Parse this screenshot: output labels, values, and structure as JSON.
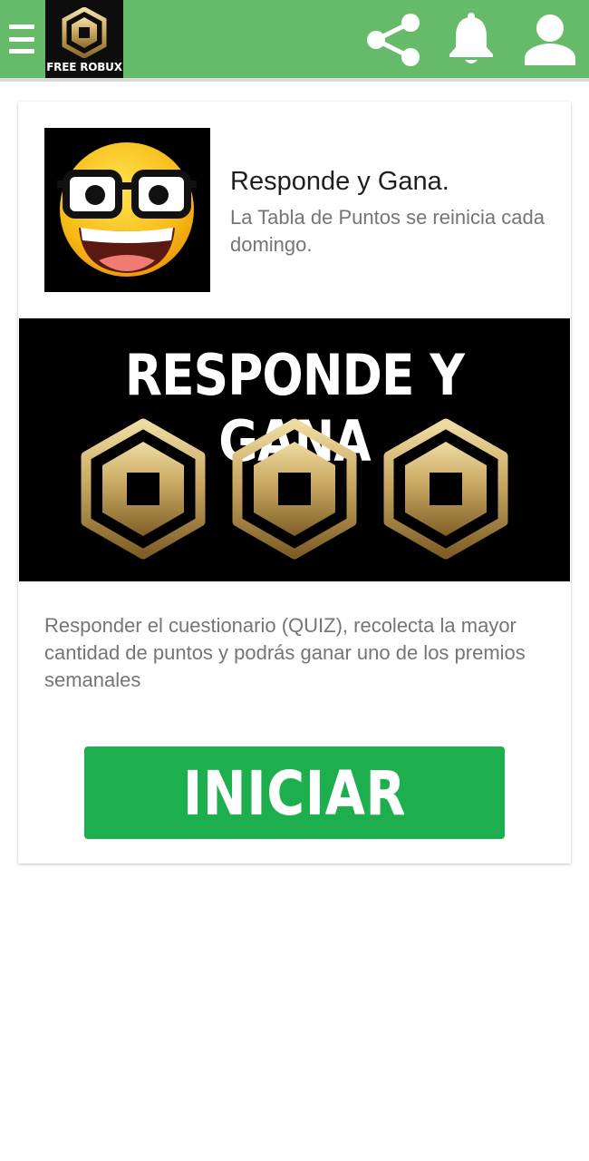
{
  "header": {
    "logo_text": "FREE ROBUX",
    "icons": [
      "menu-icon",
      "share-icon",
      "bell-icon",
      "user-icon"
    ],
    "bar_color": "#66bb6a"
  },
  "card": {
    "thumbnail_icon": "nerd-emoji",
    "title": "Responde y Gana.",
    "subtitle": "La Tabla de Puntos se reinicia cada domingo.",
    "banner_text": "RESPONDE Y GANA",
    "description": "Responder el cuestionario (QUIZ), recolecta la mayor cantidad de puntos y podrás ganar uno de los premios semanales",
    "start_label": "INICIAR",
    "start_color": "#1daf4d"
  }
}
